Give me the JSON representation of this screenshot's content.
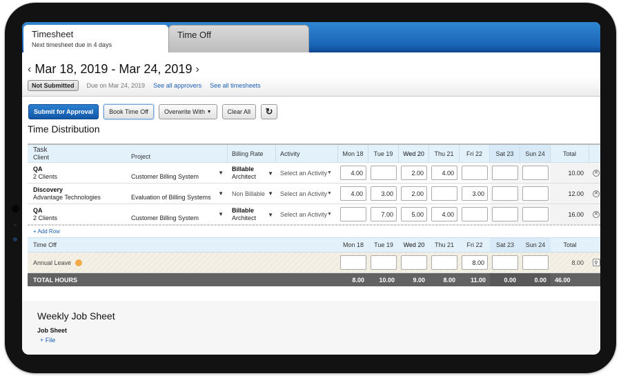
{
  "tabs": [
    {
      "label": "Timesheet",
      "sublabel": "Next timesheet due in 4 days",
      "active": true
    },
    {
      "label": "Time Off",
      "sublabel": "",
      "active": false
    }
  ],
  "header": {
    "date_range": "Mar 18, 2019 - Mar 24, 2019",
    "prev_icon": "chevron-left-icon",
    "next_icon": "chevron-right-icon",
    "status_badge": "Not Submitted",
    "due_text": "Due on Mar 24, 2019",
    "links": [
      "See all approvers",
      "See all timesheets"
    ]
  },
  "toolbar": {
    "submit": "Submit for Approval",
    "book_time_off": "Book Time Off",
    "overwrite": "Overwrite With",
    "clear_all": "Clear All",
    "refresh_icon": "↻"
  },
  "section_title": "Time Distribution",
  "grid": {
    "headers": {
      "task": "Task",
      "client": "Client",
      "project": "Project",
      "billing_rate": "Billing Rate",
      "activity": "Activity",
      "days": [
        "Mon 18",
        "Tue 19",
        "Wed 20",
        "Thu 21",
        "Fri 22",
        "Sat 23",
        "Sun 24"
      ],
      "total": "Total"
    },
    "rows": [
      {
        "task": "QA",
        "client": "2 Clients",
        "project": "Customer Billing System",
        "billing": "Billable",
        "billing_sub": "Architect",
        "activity": "Select an Activity",
        "days": [
          "4.00",
          "",
          "2.00",
          "4.00",
          "",
          "",
          ""
        ],
        "total": "10.00"
      },
      {
        "task": "Discovery",
        "client": "Advantage Technologies",
        "project": "Evaluation of Billing Systems",
        "billing": "Non Billable",
        "billing_sub": "",
        "activity": "Select an Activity",
        "days": [
          "4.00",
          "3.00",
          "2.00",
          "",
          "3.00",
          "",
          ""
        ],
        "total": "12.00"
      },
      {
        "task": "QA",
        "client": "2 Clients",
        "project": "Customer Billing System",
        "billing": "Billable",
        "billing_sub": "Architect",
        "activity": "Select an Activity",
        "days": [
          "",
          "7.00",
          "5.00",
          "4.00",
          "",
          "",
          ""
        ],
        "total": "16.00"
      }
    ],
    "add_row": "+ Add Row",
    "time_off": {
      "header": "Time Off",
      "rows": [
        {
          "label": "Annual Leave",
          "days": [
            "",
            "",
            "",
            "",
            "8.00",
            "",
            ""
          ],
          "total": "8.00"
        }
      ]
    },
    "totals": {
      "label": "TOTAL HOURS",
      "days": [
        "8.00",
        "10.00",
        "9.00",
        "8.00",
        "11.00",
        "0.00",
        "0.00"
      ],
      "total": "46.00"
    }
  },
  "job_sheet": {
    "title": "Weekly Job Sheet",
    "label": "Job Sheet",
    "add_file": "+ File"
  }
}
